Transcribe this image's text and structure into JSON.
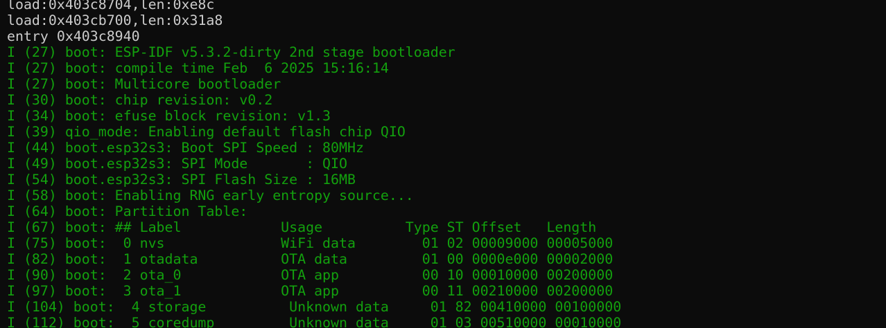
{
  "terminal": {
    "lines": [
      {
        "text": "load:0x403c8704,len:0xe8c",
        "color": "white"
      },
      {
        "text": "load:0x403cb700,len:0x31a8",
        "color": "white"
      },
      {
        "text": "entry 0x403c8940",
        "color": "white"
      },
      {
        "text": "I (27) boot: ESP-IDF v5.3.2-dirty 2nd stage bootloader",
        "color": "green"
      },
      {
        "text": "I (27) boot: compile time Feb  6 2025 15:16:14",
        "color": "green"
      },
      {
        "text": "I (27) boot: Multicore bootloader",
        "color": "green"
      },
      {
        "text": "I (30) boot: chip revision: v0.2",
        "color": "green"
      },
      {
        "text": "I (34) boot: efuse block revision: v1.3",
        "color": "green"
      },
      {
        "text": "I (39) qio_mode: Enabling default flash chip QIO",
        "color": "green"
      },
      {
        "text": "I (44) boot.esp32s3: Boot SPI Speed : 80MHz",
        "color": "green"
      },
      {
        "text": "I (49) boot.esp32s3: SPI Mode       : QIO",
        "color": "green"
      },
      {
        "text": "I (54) boot.esp32s3: SPI Flash Size : 16MB",
        "color": "green"
      },
      {
        "text": "I (58) boot: Enabling RNG early entropy source...",
        "color": "green"
      },
      {
        "text": "I (64) boot: Partition Table:",
        "color": "green"
      },
      {
        "text": "I (67) boot: ## Label            Usage          Type ST Offset   Length",
        "color": "green"
      },
      {
        "text": "I (75) boot:  0 nvs              WiFi data        01 02 00009000 00005000",
        "color": "green"
      },
      {
        "text": "I (82) boot:  1 otadata          OTA data         01 00 0000e000 00002000",
        "color": "green"
      },
      {
        "text": "I (90) boot:  2 ota_0            OTA app          00 10 00010000 00200000",
        "color": "green"
      },
      {
        "text": "I (97) boot:  3 ota_1            OTA app          00 11 00210000 00200000",
        "color": "green"
      },
      {
        "text": "I (104) boot:  4 storage          Unknown data     01 82 00410000 00100000",
        "color": "green"
      },
      {
        "text": "I (112) boot:  5 coredump         Unknown data     01 03 00510000 00010000",
        "color": "green"
      }
    ]
  }
}
